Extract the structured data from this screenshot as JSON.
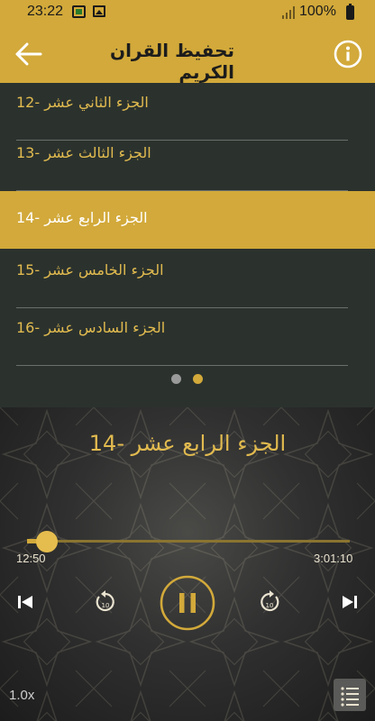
{
  "status_bar": {
    "time": "23:22",
    "battery": "100%"
  },
  "app_bar": {
    "title": "تحفيظ القران الكريم",
    "back_icon": "arrow-left-icon",
    "info_icon": "info-circle-icon"
  },
  "list": {
    "items": [
      {
        "label": "الجزء الثاني عشر -12",
        "active": false
      },
      {
        "label": "الجزء الثالث عشر -13",
        "active": false
      },
      {
        "label": "الجزء الرابع عشر -14",
        "active": true
      },
      {
        "label": "الجزء الخامس عشر -15",
        "active": false
      },
      {
        "label": "الجزء السادس عشر -16",
        "active": false
      }
    ],
    "page_count": 2,
    "current_page": 2
  },
  "player": {
    "now_playing": "الجزء الرابع عشر -14",
    "current_time": "12:50",
    "total_time": "3:01:10",
    "progress_fraction": 0.07,
    "skip_seconds": "10",
    "speed": "1.0x",
    "state": "playing"
  },
  "colors": {
    "accent": "#d2a93a",
    "accent_text": "#e2bb4f",
    "list_background": "#2b322e",
    "inactive_dot": "#9a9a9a"
  }
}
